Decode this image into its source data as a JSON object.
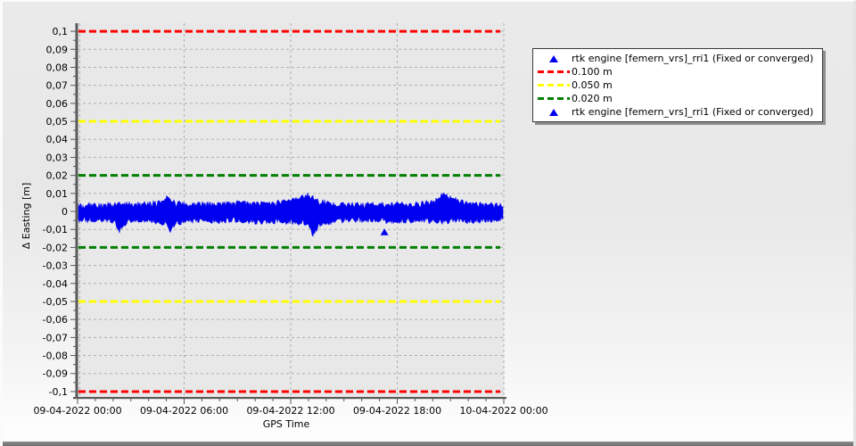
{
  "window": {
    "background_top": "#eaeaea",
    "background_bottom": "#fdfdfd",
    "bottom_bar_color": "#757575"
  },
  "chart_data": {
    "type": "scatter",
    "title": "",
    "xlabel": "GPS Time",
    "ylabel": "Δ Easting [m]",
    "ylim": [
      -0.103,
      0.1045
    ],
    "xlim_labels": [
      "09-04-2022 00:00",
      "10-04-2022 00:00"
    ],
    "grid": true,
    "plot_bg": "#e8e8e8",
    "grid_color": "#b0b0b0",
    "axis_color": "#5a5a5a",
    "series_color": "#0000f0",
    "legend_position": "outside-top-right",
    "xticks": [
      {
        "t": 0.0,
        "label": "09-04-2022 00:00"
      },
      {
        "t": 0.25,
        "label": "09-04-2022 06:00"
      },
      {
        "t": 0.5,
        "label": "09-04-2022 12:00"
      },
      {
        "t": 0.75,
        "label": "09-04-2022 18:00"
      },
      {
        "t": 1.0,
        "label": "10-04-2022 00:00"
      }
    ],
    "x_minor_divisions": 24,
    "yticks": [
      {
        "value": 0.1,
        "label": "0,1"
      },
      {
        "value": 0.09,
        "label": "0,09"
      },
      {
        "value": 0.08,
        "label": "0,08"
      },
      {
        "value": 0.07,
        "label": "0,07"
      },
      {
        "value": 0.06,
        "label": "0,06"
      },
      {
        "value": 0.05,
        "label": "0,05"
      },
      {
        "value": 0.04,
        "label": "0,04"
      },
      {
        "value": 0.03,
        "label": "0,03"
      },
      {
        "value": 0.02,
        "label": "0,02"
      },
      {
        "value": 0.01,
        "label": "0,01"
      },
      {
        "value": 0.0,
        "label": "0"
      },
      {
        "value": -0.01,
        "label": "-0,01"
      },
      {
        "value": -0.02,
        "label": "-0,02"
      },
      {
        "value": -0.03,
        "label": "-0,03"
      },
      {
        "value": -0.04,
        "label": "-0,04"
      },
      {
        "value": -0.05,
        "label": "-0,05"
      },
      {
        "value": -0.06,
        "label": "-0,06"
      },
      {
        "value": -0.07,
        "label": "-0,07"
      },
      {
        "value": -0.08,
        "label": "-0,08"
      },
      {
        "value": -0.09,
        "label": "-0,09"
      },
      {
        "value": -0.1,
        "label": "-0,1"
      }
    ],
    "thresholds": [
      {
        "value": 0.1,
        "color": "#ff0000",
        "label": "0.100 m"
      },
      {
        "value": 0.05,
        "color": "#ffff00",
        "label": "0.050 m"
      },
      {
        "value": 0.02,
        "color": "#008000",
        "label": "0.020 m"
      },
      {
        "value": -0.02,
        "color": "#008000",
        "label": "0.020 m"
      },
      {
        "value": -0.05,
        "color": "#ffff00",
        "label": "0.050 m"
      },
      {
        "value": -0.1,
        "color": "#ff0000",
        "label": "0.100 m"
      }
    ],
    "series": [
      {
        "name": "rtk engine [femern_vrs]_rri1 (Fixed or converged)",
        "marker": "triangle",
        "color": "#0000f0",
        "envelope": [
          [
            0.0,
            0.004,
            -0.006
          ],
          [
            0.03,
            0.0045,
            -0.0058
          ],
          [
            0.06,
            0.0042,
            -0.006
          ],
          [
            0.085,
            0.0045,
            -0.0062
          ],
          [
            0.095,
            0.0048,
            -0.0125
          ],
          [
            0.105,
            0.0045,
            -0.0085
          ],
          [
            0.12,
            0.0048,
            -0.006
          ],
          [
            0.16,
            0.0052,
            -0.0062
          ],
          [
            0.19,
            0.006,
            -0.007
          ],
          [
            0.21,
            0.0085,
            -0.008
          ],
          [
            0.215,
            0.007,
            -0.013
          ],
          [
            0.225,
            0.0058,
            -0.0085
          ],
          [
            0.25,
            0.0048,
            -0.0062
          ],
          [
            0.3,
            0.005,
            -0.006
          ],
          [
            0.34,
            0.0052,
            -0.0065
          ],
          [
            0.38,
            0.0055,
            -0.006
          ],
          [
            0.42,
            0.005,
            -0.0068
          ],
          [
            0.46,
            0.0055,
            -0.0065
          ],
          [
            0.5,
            0.0065,
            -0.007
          ],
          [
            0.54,
            0.01,
            -0.0075
          ],
          [
            0.553,
            0.008,
            -0.0148
          ],
          [
            0.565,
            0.0062,
            -0.009
          ],
          [
            0.6,
            0.005,
            -0.0065
          ],
          [
            0.65,
            0.0045,
            -0.0058
          ],
          [
            0.7,
            0.0048,
            -0.006
          ],
          [
            0.75,
            0.0046,
            -0.0065
          ],
          [
            0.8,
            0.005,
            -0.006
          ],
          [
            0.84,
            0.0065,
            -0.0065
          ],
          [
            0.862,
            0.0108,
            -0.0068
          ],
          [
            0.885,
            0.008,
            -0.006
          ],
          [
            0.92,
            0.0052,
            -0.0065
          ],
          [
            0.96,
            0.0046,
            -0.006
          ],
          [
            1.0,
            0.0042,
            -0.0055
          ]
        ],
        "outliers": [
          [
            0.72,
            -0.0115
          ]
        ]
      }
    ],
    "legend": [
      {
        "symbol": "triangle",
        "color": "#0000f0",
        "label": "rtk engine [femern_vrs]_rri1 (Fixed or converged)"
      },
      {
        "symbol": "dashed-line",
        "color": "#ff0000",
        "label": "0.100 m"
      },
      {
        "symbol": "dashed-line",
        "color": "#ffff00",
        "label": "0.050 m"
      },
      {
        "symbol": "dashed-line",
        "color": "#008000",
        "label": "0.020 m"
      },
      {
        "symbol": "triangle",
        "color": "#0000f0",
        "label": "rtk engine [femern_vrs]_rri1 (Fixed or converged)"
      }
    ]
  }
}
